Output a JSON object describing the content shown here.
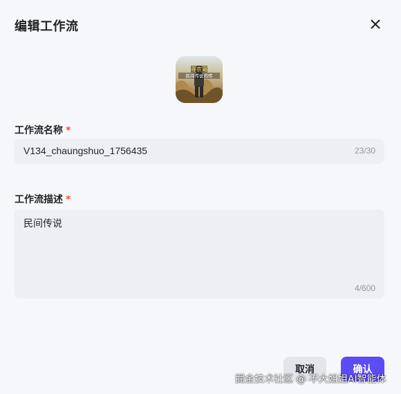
{
  "dialog": {
    "title": "编辑工作流",
    "close_icon": "close-icon"
  },
  "avatar": {
    "icon": "workflow-cover-image",
    "overlay_line1": "寻农哥",
    "overlay_line2": "民间传说的传"
  },
  "name_field": {
    "label": "工作流名称",
    "required_mark": "*",
    "value": "V134_chaungshuo_1756435",
    "counter": "23/30"
  },
  "description_field": {
    "label": "工作流描述",
    "required_mark": "*",
    "value": "民间传说",
    "counter": "4/600"
  },
  "buttons": {
    "cancel_label": "取消",
    "confirm_label": "确认"
  },
  "watermark": {
    "text": "掘金技术社区 @ 不大姐姐AI智能体"
  },
  "colors": {
    "accent": "#5b4cf5",
    "required": "#f54a45",
    "background": "#f6f7fb",
    "field_background": "#eeeff4"
  }
}
